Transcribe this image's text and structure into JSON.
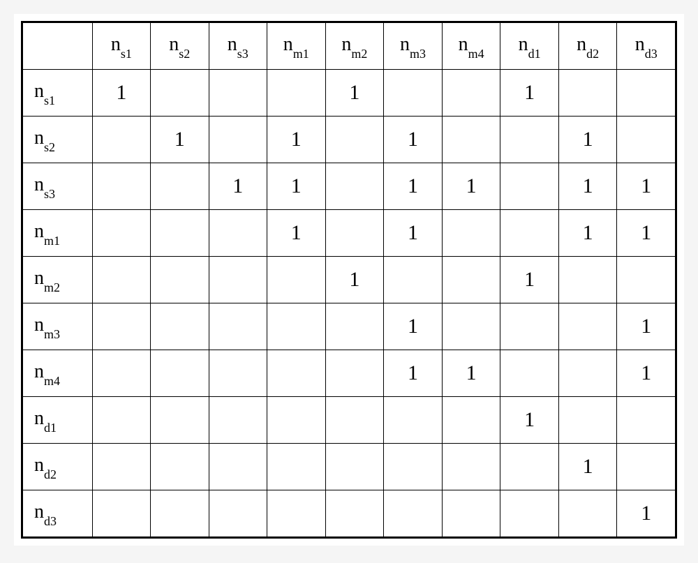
{
  "chart_data": {
    "type": "table",
    "title": "",
    "columns": [
      {
        "base": "n",
        "sub": "s1"
      },
      {
        "base": "n",
        "sub": "s2"
      },
      {
        "base": "n",
        "sub": "s3"
      },
      {
        "base": "n",
        "sub": "m1"
      },
      {
        "base": "n",
        "sub": "m2"
      },
      {
        "base": "n",
        "sub": "m3"
      },
      {
        "base": "n",
        "sub": "m4"
      },
      {
        "base": "n",
        "sub": "d1"
      },
      {
        "base": "n",
        "sub": "d2"
      },
      {
        "base": "n",
        "sub": "d3"
      }
    ],
    "rows": [
      {
        "base": "n",
        "sub": "s1"
      },
      {
        "base": "n",
        "sub": "s2"
      },
      {
        "base": "n",
        "sub": "s3"
      },
      {
        "base": "n",
        "sub": "m1"
      },
      {
        "base": "n",
        "sub": "m2"
      },
      {
        "base": "n",
        "sub": "m3"
      },
      {
        "base": "n",
        "sub": "m4"
      },
      {
        "base": "n",
        "sub": "d1"
      },
      {
        "base": "n",
        "sub": "d2"
      },
      {
        "base": "n",
        "sub": "d3"
      }
    ],
    "matrix": [
      [
        "1",
        "",
        "",
        "",
        "1",
        "",
        "",
        "1",
        "",
        ""
      ],
      [
        "",
        "1",
        "",
        "1",
        "",
        "1",
        "",
        "",
        "1",
        ""
      ],
      [
        "",
        "",
        "1",
        "1",
        "",
        "1",
        "1",
        "",
        "1",
        "1"
      ],
      [
        "",
        "",
        "",
        "1",
        "",
        "1",
        "",
        "",
        "1",
        "1"
      ],
      [
        "",
        "",
        "",
        "",
        "1",
        "",
        "",
        "1",
        "",
        ""
      ],
      [
        "",
        "",
        "",
        "",
        "",
        "1",
        "",
        "",
        "",
        "1"
      ],
      [
        "",
        "",
        "",
        "",
        "",
        "1",
        "1",
        "",
        "",
        "1"
      ],
      [
        "",
        "",
        "",
        "",
        "",
        "",
        "",
        "1",
        "",
        ""
      ],
      [
        "",
        "",
        "",
        "",
        "",
        "",
        "",
        "",
        "1",
        ""
      ],
      [
        "",
        "",
        "",
        "",
        "",
        "",
        "",
        "",
        "",
        "1"
      ]
    ]
  }
}
